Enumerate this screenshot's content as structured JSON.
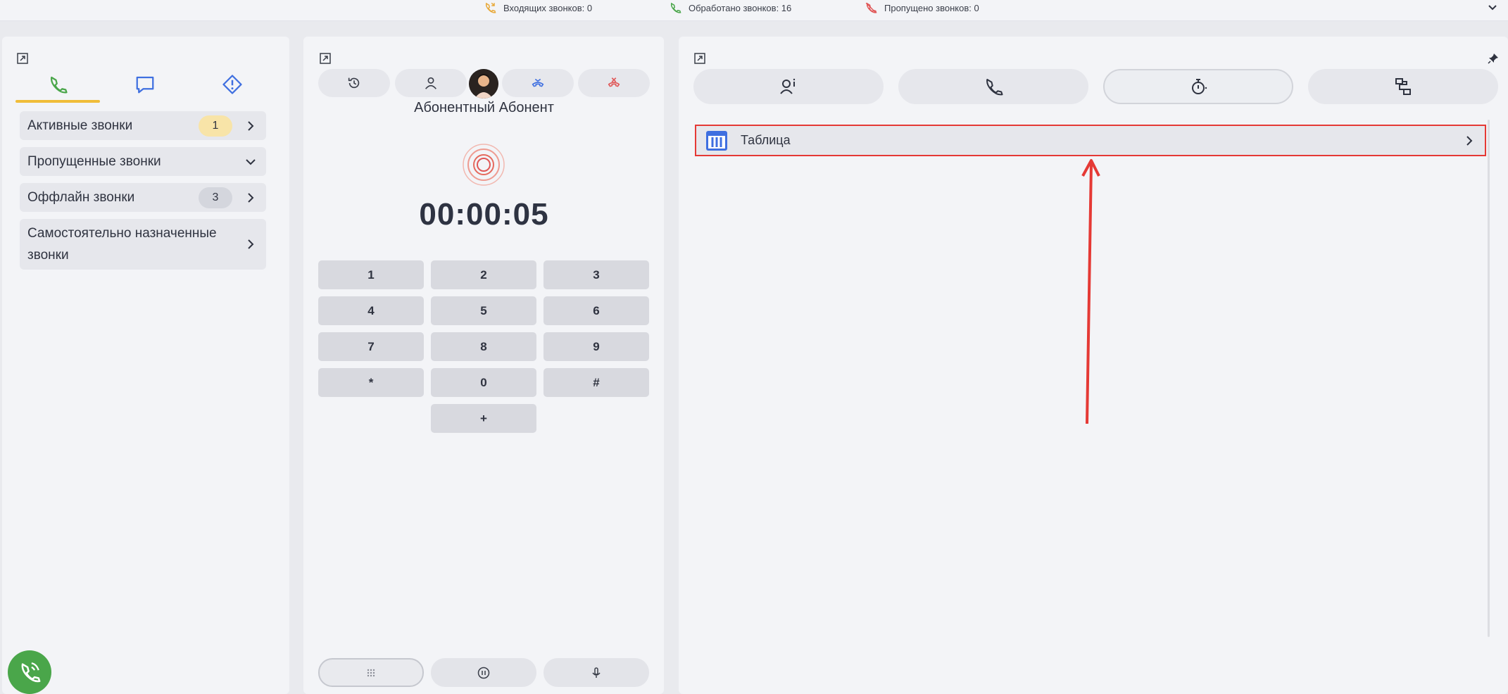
{
  "topbar": {
    "incoming": "Входящих звонков: 0",
    "processed": "Обработано звонков: 16",
    "missed": "Пропущено звонков: 0"
  },
  "left_panel": {
    "tabs": [
      "phone-icon",
      "chat-icon",
      "alert-icon"
    ],
    "items": [
      {
        "label": "Активные звонки",
        "badge": "1"
      },
      {
        "label": "Пропущенные звонки"
      },
      {
        "label": "Оффлайн звонки",
        "badge": "3"
      },
      {
        "label": "Самостоятельно назначенные звонки"
      }
    ]
  },
  "call": {
    "subscriber": "Абонентный Абонент",
    "timer": "00:00:05"
  },
  "dialpad": {
    "keys": [
      "1",
      "2",
      "3",
      "4",
      "5",
      "6",
      "7",
      "8",
      "9",
      "*",
      "0",
      "#",
      "+"
    ]
  },
  "right_panel": {
    "tabs": [
      "caller-info-icon",
      "phone-icon",
      "timer-icon",
      "routing-icon"
    ],
    "table_label": "Таблица"
  },
  "colors": {
    "accent": "#f0bd3a",
    "highlight": "#e53935",
    "call_green": "#4aa64a",
    "hangup_red": "#e05757",
    "transfer_blue": "#3f6fe0"
  }
}
